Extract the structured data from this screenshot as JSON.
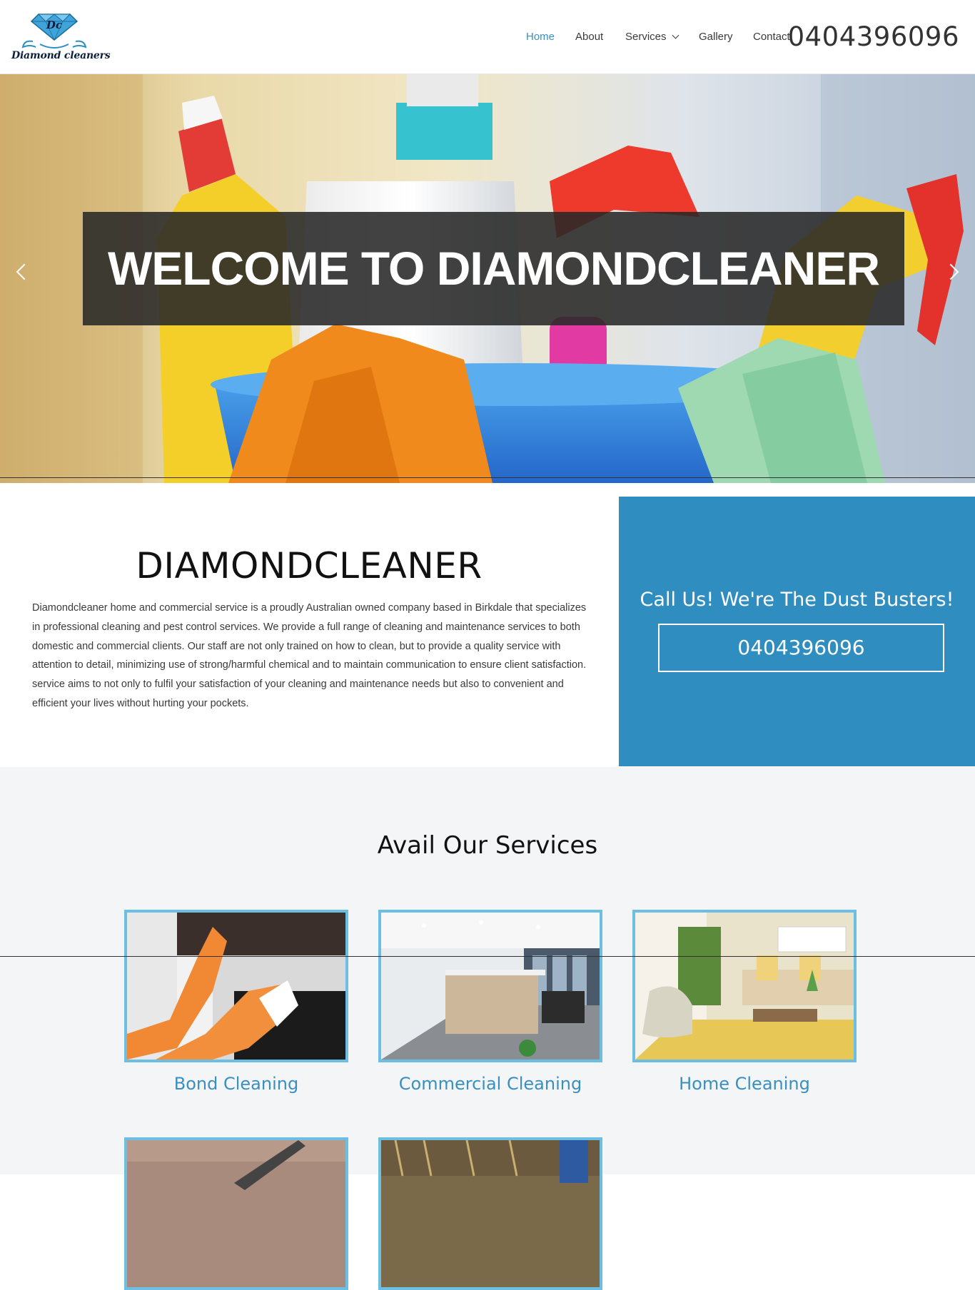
{
  "header": {
    "logo_monogram": "Dc",
    "logo_text": "Diamond cleaners",
    "nav": [
      {
        "label": "Home",
        "active": true
      },
      {
        "label": "About",
        "active": false
      },
      {
        "label": "Services",
        "active": false,
        "has_dropdown": true
      },
      {
        "label": "Gallery",
        "active": false
      },
      {
        "label": "Contact",
        "active": false
      }
    ],
    "phone": "0404396096"
  },
  "hero": {
    "title": "WELCOME TO DIAMONDCLEANER",
    "prev_icon": "chevron-left-icon",
    "next_icon": "chevron-right-icon"
  },
  "about": {
    "title": "DIAMONDCLEANER",
    "text": "Diamondcleaner home and commercial service is a proudly Australian owned company based in Birkdale that specializes in professional cleaning and pest control services. We provide a full range of cleaning and maintenance services to both domestic and commercial clients. Our staff are not only trained on how to clean, but to provide a quality service with attention to detail, minimizing use of strong/harmful chemical and to maintain communication to ensure client satisfaction. service aims to not only to fulfil your satisfaction of your cleaning and maintenance needs but also to convenient and efficient your lives without hurting your pockets."
  },
  "cta": {
    "heading": "Call Us! We're The Dust Busters!",
    "phone": "0404396096"
  },
  "services": {
    "title": "Avail Our Services",
    "cards": [
      {
        "label": "Bond Cleaning"
      },
      {
        "label": "Commercial Cleaning"
      },
      {
        "label": "Home Cleaning"
      },
      {
        "label": ""
      },
      {
        "label": ""
      }
    ]
  },
  "colors": {
    "accent": "#3a8fc1",
    "cta_bg": "#2f8ebf",
    "card_border": "#6cbfe3",
    "services_bg": "#f4f5f7"
  }
}
